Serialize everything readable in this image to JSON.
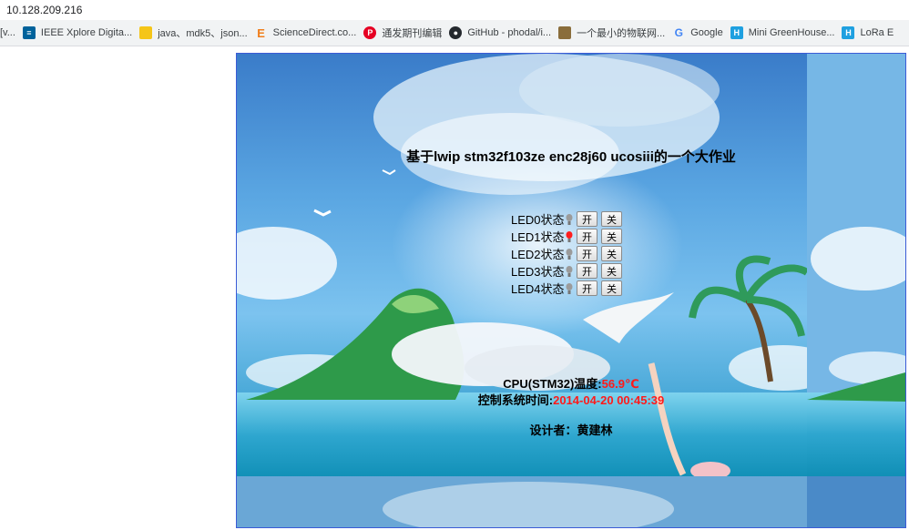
{
  "browser": {
    "url": "10.128.209.216",
    "bookmarks": [
      {
        "label": "[v...",
        "icon": "bookmark-icon",
        "color": "#888888"
      },
      {
        "label": "IEEE Xplore Digita...",
        "icon": "ieee-icon",
        "color": "#00629b"
      },
      {
        "label": "java、mdk5、json...",
        "icon": "folder-icon",
        "color": "#f5c518"
      },
      {
        "label": "ScienceDirect.co...",
        "icon": "sciencedirect-icon",
        "color": "#f07d1a"
      },
      {
        "label": "通发期刊编辑",
        "icon": "pinterest-icon",
        "color": "#e60023"
      },
      {
        "label": "GitHub - phodal/i...",
        "icon": "github-icon",
        "color": "#24292e"
      },
      {
        "label": "一个最小的物联网...",
        "icon": "image-icon",
        "color": "#8a6d3b"
      },
      {
        "label": "Google",
        "icon": "google-icon",
        "color": "#4285f4"
      },
      {
        "label": "Mini GreenHouse...",
        "icon": "hackster-icon",
        "color": "#1fa0e0"
      },
      {
        "label": "LoRa E",
        "icon": "hackster-icon",
        "color": "#1fa0e0"
      }
    ]
  },
  "page": {
    "title": "基于lwip stm32f103ze enc28j60 ucosiii的一个大作业",
    "leds": [
      {
        "label": "LED0状态",
        "on": false,
        "on_label": "开",
        "off_label": "关"
      },
      {
        "label": "LED1状态",
        "on": true,
        "on_label": "开",
        "off_label": "关"
      },
      {
        "label": "LED2状态",
        "on": false,
        "on_label": "开",
        "off_label": "关"
      },
      {
        "label": "LED3状态",
        "on": false,
        "on_label": "开",
        "off_label": "关"
      },
      {
        "label": "LED4状态",
        "on": false,
        "on_label": "开",
        "off_label": "关"
      }
    ],
    "cpu_label": "CPU(STM32)温度:",
    "cpu_value": "56.9℃",
    "time_label": "控制系统时间:",
    "time_value": "2014-04-20 00:45:39",
    "designer": "设计者：黄建林"
  }
}
